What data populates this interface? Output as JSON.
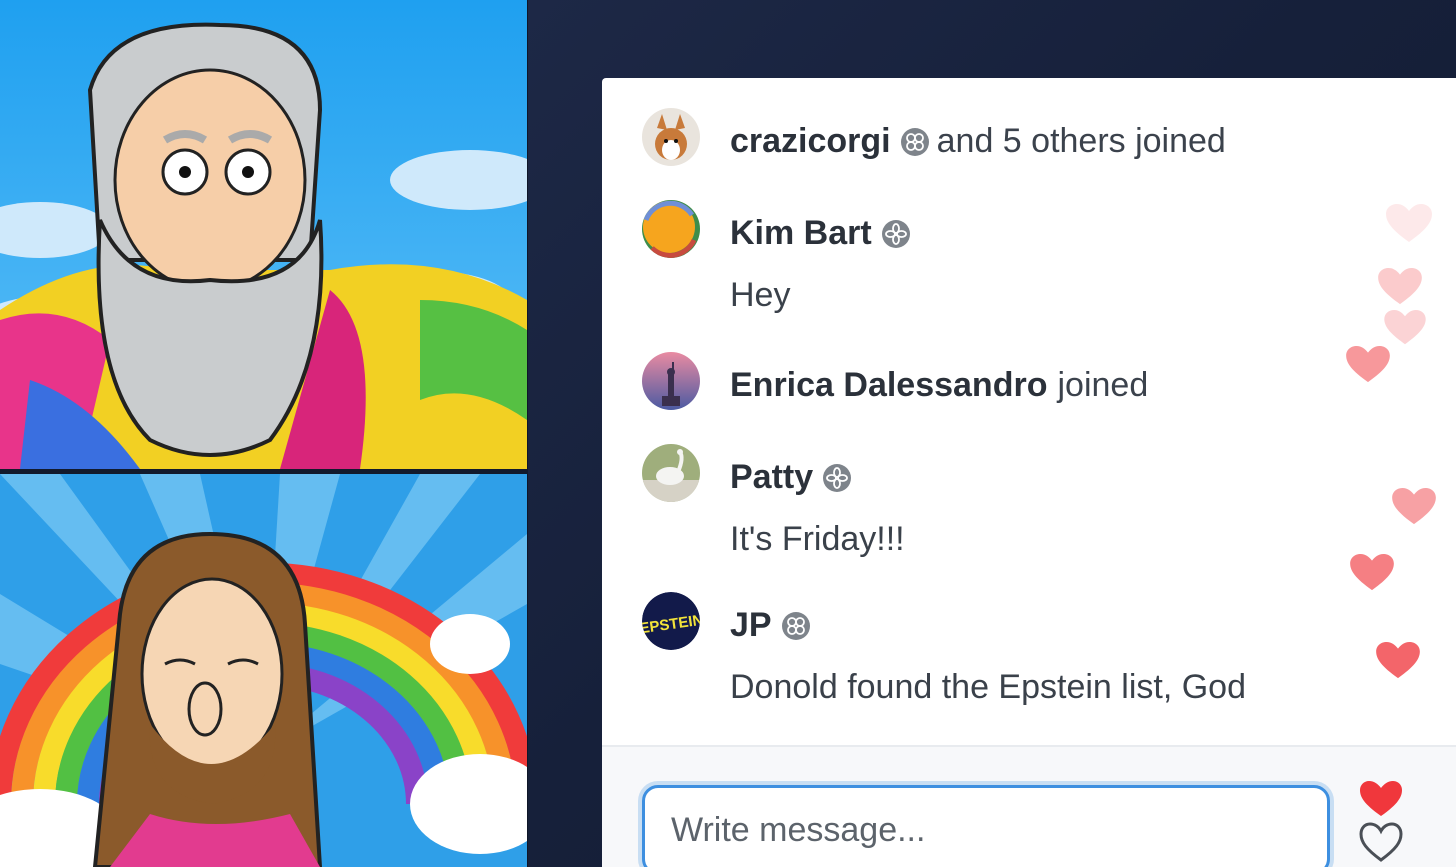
{
  "video_tiles": [
    {
      "id": "top",
      "subject": "cartoon-old-man-beard-tie-dye-shirt"
    },
    {
      "id": "bottom",
      "subject": "cartoon-bearded-man-rainbow"
    }
  ],
  "chat": {
    "messages": [
      {
        "name": "crazicorgi",
        "suffix": "and 5 others joined",
        "text": "",
        "avatar": "corgi-photo",
        "badge": "flower-badge-icon"
      },
      {
        "name": "Kim Bart",
        "suffix": "",
        "text": "Hey",
        "avatar": "orange-circle-avatar",
        "badge": "flower-badge-icon"
      },
      {
        "name": "Enrica Dalessandro",
        "suffix": "joined",
        "text": "",
        "avatar": "statue-of-liberty-photo",
        "badge": ""
      },
      {
        "name": "Patty",
        "suffix": "",
        "text": "It's Friday!!!",
        "avatar": "white-bird-photo",
        "badge": "flower-badge-icon"
      },
      {
        "name": "JP",
        "suffix": "",
        "text": "Donold found the Epstein list, God",
        "avatar": "epstein-text-logo",
        "badge": "flower-badge-icon"
      }
    ],
    "jp_avatar_text": "EPSTEIN"
  },
  "composer": {
    "placeholder": "Write message...",
    "heart_icon": "heart-outline-icon"
  },
  "colors": {
    "accent": "#3d8fe0",
    "heart": "#f2555a",
    "panel_bg": "#ffffff",
    "backdrop": "#141d33"
  }
}
